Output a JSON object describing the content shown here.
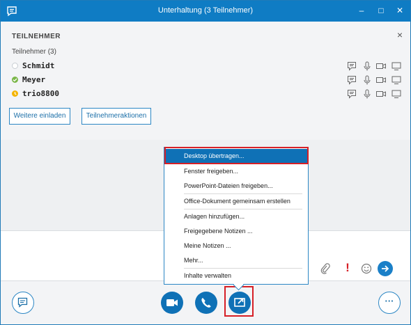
{
  "window": {
    "title": "Unterhaltung (3 Teilnehmer)",
    "minimize_label": "–",
    "maximize_label": "□",
    "close_label": "✕",
    "accent": "#0f7cc4"
  },
  "participants": {
    "header": "TEILNEHMER",
    "close_label": "×",
    "count_label": "Teilnehmer (3)",
    "people": [
      {
        "name": "Schmidt",
        "status": "offline",
        "status_color": "#c8cdd2"
      },
      {
        "name": "Meyer",
        "status": "available",
        "status_color": "#7ab648"
      },
      {
        "name": "trio8800",
        "status": "away",
        "status_color": "#f4b400"
      }
    ],
    "action_icons": [
      "chat-icon",
      "microphone-icon",
      "video-icon",
      "screen-icon"
    ],
    "invite_button": "Weitere einladen",
    "actions_button": "Teilnehmeraktionen"
  },
  "share_menu": {
    "items": [
      {
        "label": "Desktop übertragen...",
        "selected": true
      },
      {
        "label": "Fenster freigeben...",
        "selected": false
      },
      {
        "label": "PowerPoint-Dateien freigeben...",
        "selected": false
      },
      {
        "label": "Office-Dokument gemeinsam erstellen",
        "selected": false
      },
      {
        "label": "Anlagen hinzufügen...",
        "selected": false
      },
      {
        "label": "Freigegebene Notizen ...",
        "selected": false
      },
      {
        "label": "Meine Notizen ...",
        "selected": false
      },
      {
        "label": "Mehr...",
        "selected": false
      },
      {
        "label": "Inhalte verwalten",
        "selected": false
      }
    ]
  },
  "compose": {
    "icons": [
      "attach-icon",
      "importance-icon",
      "emoji-icon",
      "send-icon"
    ],
    "importance_glyph": "!"
  },
  "bottom": {
    "buttons": [
      "im-icon",
      "video-call-icon",
      "phone-icon",
      "share-screen-icon",
      "more-icon"
    ],
    "more_glyph": "···"
  },
  "colors": {
    "highlight": "#d61f26",
    "button_blue": "#0f71b6"
  }
}
